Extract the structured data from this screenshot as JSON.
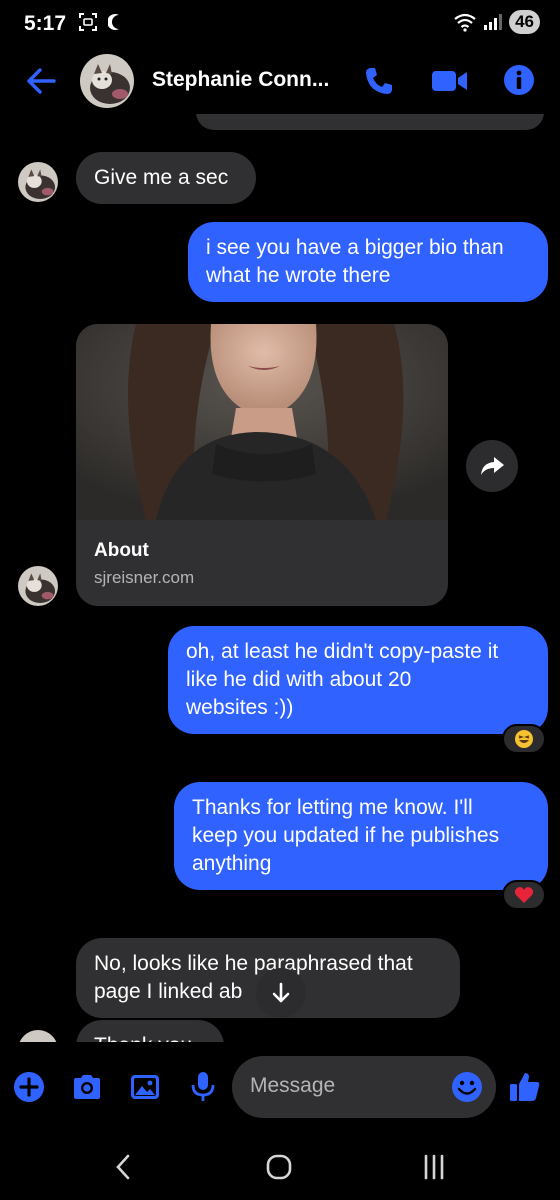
{
  "status_bar": {
    "time": "5:17",
    "battery": "46"
  },
  "header": {
    "contact_name": "Stephanie Conn..."
  },
  "colors": {
    "accent": "#2f62ff",
    "bubble_in": "#303032",
    "background": "#000000"
  },
  "messages": {
    "m1": {
      "text": "Give me a sec"
    },
    "m2": {
      "line1": "i see you have a bigger bio than",
      "line2": "what he wrote there"
    },
    "link": {
      "title": "About",
      "url": "sjreisner.com"
    },
    "m3": {
      "line1": "oh, at least he didn't copy-paste it",
      "line2": "like he did with about 20",
      "line3": "websites :))"
    },
    "m4": {
      "line1": "Thanks for letting me know. I'll",
      "line2": "keep you updated if he publishes",
      "line3": "anything"
    },
    "m5": {
      "line1": "No, looks like he paraphrased that",
      "line2": "page I linked ab"
    },
    "m6": {
      "text": "Thank you"
    }
  },
  "reactions": {
    "r1": "laughing-emoji",
    "r2": "heart-emoji"
  },
  "composer": {
    "placeholder": "Message"
  },
  "icons": [
    "back-arrow-icon",
    "phone-icon",
    "video-camera-icon",
    "info-icon",
    "share-icon",
    "arrow-down-icon",
    "plus-icon",
    "camera-icon",
    "image-icon",
    "microphone-icon",
    "emoji-icon",
    "thumbs-up-icon"
  ]
}
